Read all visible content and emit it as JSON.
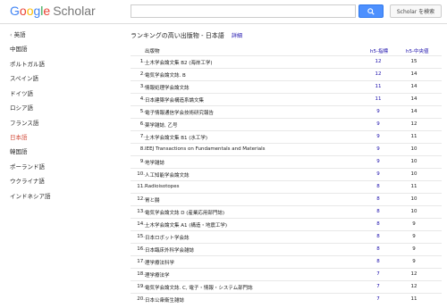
{
  "header": {
    "logo_google": [
      "G",
      "o",
      "o",
      "g",
      "l",
      "e"
    ],
    "logo_scholar": "Scholar",
    "search_value": "",
    "scholar_search_label": "Scholar を検索"
  },
  "sidebar": {
    "items": [
      {
        "label": "英語",
        "chevron": "‹"
      },
      {
        "label": "中国語"
      },
      {
        "label": "ポルトガル語"
      },
      {
        "label": "スペイン語"
      },
      {
        "label": "ドイツ語"
      },
      {
        "label": "ロシア語"
      },
      {
        "label": "フランス語"
      },
      {
        "label": "日本語",
        "active": true
      },
      {
        "label": "韓国語"
      },
      {
        "label": "ポーランド語"
      },
      {
        "label": "ウクライナ語"
      },
      {
        "label": "インドネシア語"
      }
    ]
  },
  "main": {
    "heading": "ランキングの高い出版物 - 日本語",
    "detail_link": "詳細",
    "columns": {
      "publication": "出版物",
      "h5_index": "h5-指標",
      "h5_median": "h5-中央値"
    },
    "rows": [
      {
        "rank": "1.",
        "pub": "土木学会論文集 B2 (海岸工学)",
        "h5": "12",
        "h5m": "15"
      },
      {
        "rank": "2.",
        "pub": "電気学会論文誌. B",
        "h5": "12",
        "h5m": "14"
      },
      {
        "rank": "3.",
        "pub": "情報処理学会論文誌",
        "h5": "11",
        "h5m": "14"
      },
      {
        "rank": "4.",
        "pub": "日本建築学会構造系論文集",
        "h5": "11",
        "h5m": "14"
      },
      {
        "rank": "5.",
        "pub": "電子情報通信学会技術研究報告",
        "h5": "9",
        "h5m": "14"
      },
      {
        "rank": "6.",
        "pub": "薬学雑誌, 乙号",
        "h5": "9",
        "h5m": "12"
      },
      {
        "rank": "7.",
        "pub": "土木学会論文集 B1 (水工学)",
        "h5": "9",
        "h5m": "11"
      },
      {
        "rank": "8.",
        "pub": "IEEJ Transactions on Fundamentals and Materials",
        "h5": "9",
        "h5m": "10"
      },
      {
        "rank": "9.",
        "pub": "地学雑誌",
        "h5": "9",
        "h5m": "10"
      },
      {
        "rank": "10.",
        "pub": "人工知能学会論文誌",
        "h5": "9",
        "h5m": "10"
      },
      {
        "rank": "11.",
        "pub": "Radioisotopes",
        "h5": "8",
        "h5m": "11"
      },
      {
        "rank": "12.",
        "pub": "胃と腸",
        "h5": "8",
        "h5m": "10"
      },
      {
        "rank": "13.",
        "pub": "電気学会論文誌 D (産業応用部門誌)",
        "h5": "8",
        "h5m": "10"
      },
      {
        "rank": "14.",
        "pub": "土木学会論文集 A1 (構造・地震工学)",
        "h5": "8",
        "h5m": "9"
      },
      {
        "rank": "15.",
        "pub": "日本ロボット学会誌",
        "h5": "8",
        "h5m": "9"
      },
      {
        "rank": "16.",
        "pub": "日本臨床外科学会雑誌",
        "h5": "8",
        "h5m": "9"
      },
      {
        "rank": "17.",
        "pub": "理学療法科学",
        "h5": "8",
        "h5m": "9"
      },
      {
        "rank": "18.",
        "pub": "理学療法学",
        "h5": "7",
        "h5m": "12"
      },
      {
        "rank": "19.",
        "pub": "電気学会論文誌. C, 電子・情報・システム部門誌",
        "h5": "7",
        "h5m": "12"
      },
      {
        "rank": "20.",
        "pub": "日本公衆衛生雑誌",
        "h5": "7",
        "h5m": "11"
      }
    ]
  },
  "colors": {
    "link": "#1a0dab",
    "active": "#d14836",
    "button": "#4d90fe"
  }
}
